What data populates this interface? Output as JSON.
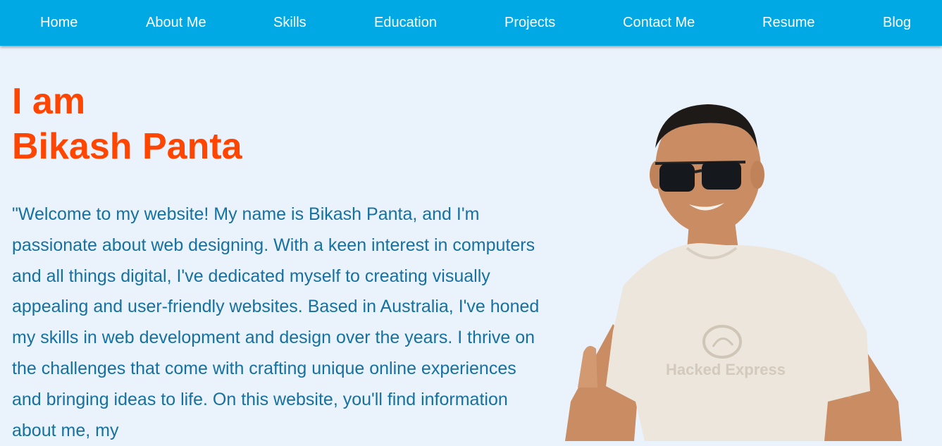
{
  "nav": {
    "items": [
      "Home",
      "About Me",
      "Skills",
      "Education",
      "Projects",
      "Contact Me",
      "Resume",
      "Blog"
    ]
  },
  "hero": {
    "line1": "I am",
    "line2": "Bikash Panta",
    "intro": "\"Welcome to my website! My name is Bikash Panta, and I'm passionate about web designing. With a keen interest in computers and all things digital, I've dedicated myself to creating visually appealing and user-friendly websites. Based in Australia, I've honed my skills in web development and design over the years. I thrive on the challenges that come with crafting unique online experiences and bringing ideas to life. On this website, you'll find information about me, my",
    "photo_shirt_text": "Hacked Express"
  },
  "colors": {
    "nav_bg": "#00a9e4",
    "page_bg": "#eaf2fb",
    "heading": "#ff4500",
    "body_text": "#1670a0"
  }
}
